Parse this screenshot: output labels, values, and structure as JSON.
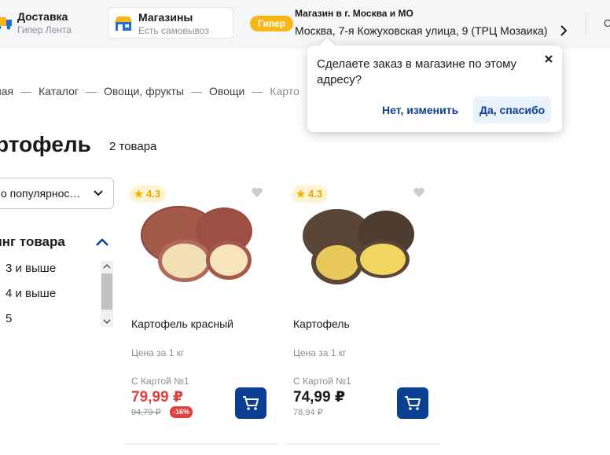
{
  "header": {
    "delivery": {
      "title": "Доставка",
      "subtitle": "Гипер Лента",
      "icon": "delivery-truck-icon"
    },
    "stores": {
      "title": "Магазины",
      "subtitle": "Есть самовывоз",
      "icon": "store-icon"
    },
    "store_type_badge": "Гипер",
    "store_city": "Магазин в г. Москва и МО",
    "store_address": "Москва, 7-я Кожуховская улица, 9 (ТРЦ Мозаика)",
    "cut_label": "С"
  },
  "breadcrumb": {
    "items": [
      "ная",
      "Каталог",
      "Овощи, фрукты",
      "Овощи",
      "Карто"
    ],
    "separator": "—"
  },
  "page": {
    "title": "ртофель",
    "count": "2 товара"
  },
  "sort": {
    "value": "о популярнос…"
  },
  "rating_filter": {
    "title": "тинг товара",
    "options": [
      "3 и выше",
      "4 и выше",
      "5"
    ]
  },
  "products": [
    {
      "rating": "4.3",
      "name": "Картофель красный",
      "unit_price": "Цена за 1 кг",
      "card_label": "С Картой №1",
      "price": "79,99 ₽",
      "old_price": "94,79 ₽",
      "discount": "-16%"
    },
    {
      "rating": "4.3",
      "name": "Картофель",
      "unit_price": "Цена за 1 кг",
      "card_label": "С Картой №1",
      "price": "74,99 ₽",
      "old_price": "78,94 ₽"
    }
  ],
  "popup": {
    "text": "Сделаете заказ в магазине по этому адресу?",
    "no_label": "Нет, изменить",
    "yes_label": "Да, спасибо"
  },
  "colors": {
    "brand_blue": "#0a3f93",
    "accent_yellow": "#f8b615",
    "price_red": "#e0413c",
    "rating_star": "#f2b200"
  }
}
